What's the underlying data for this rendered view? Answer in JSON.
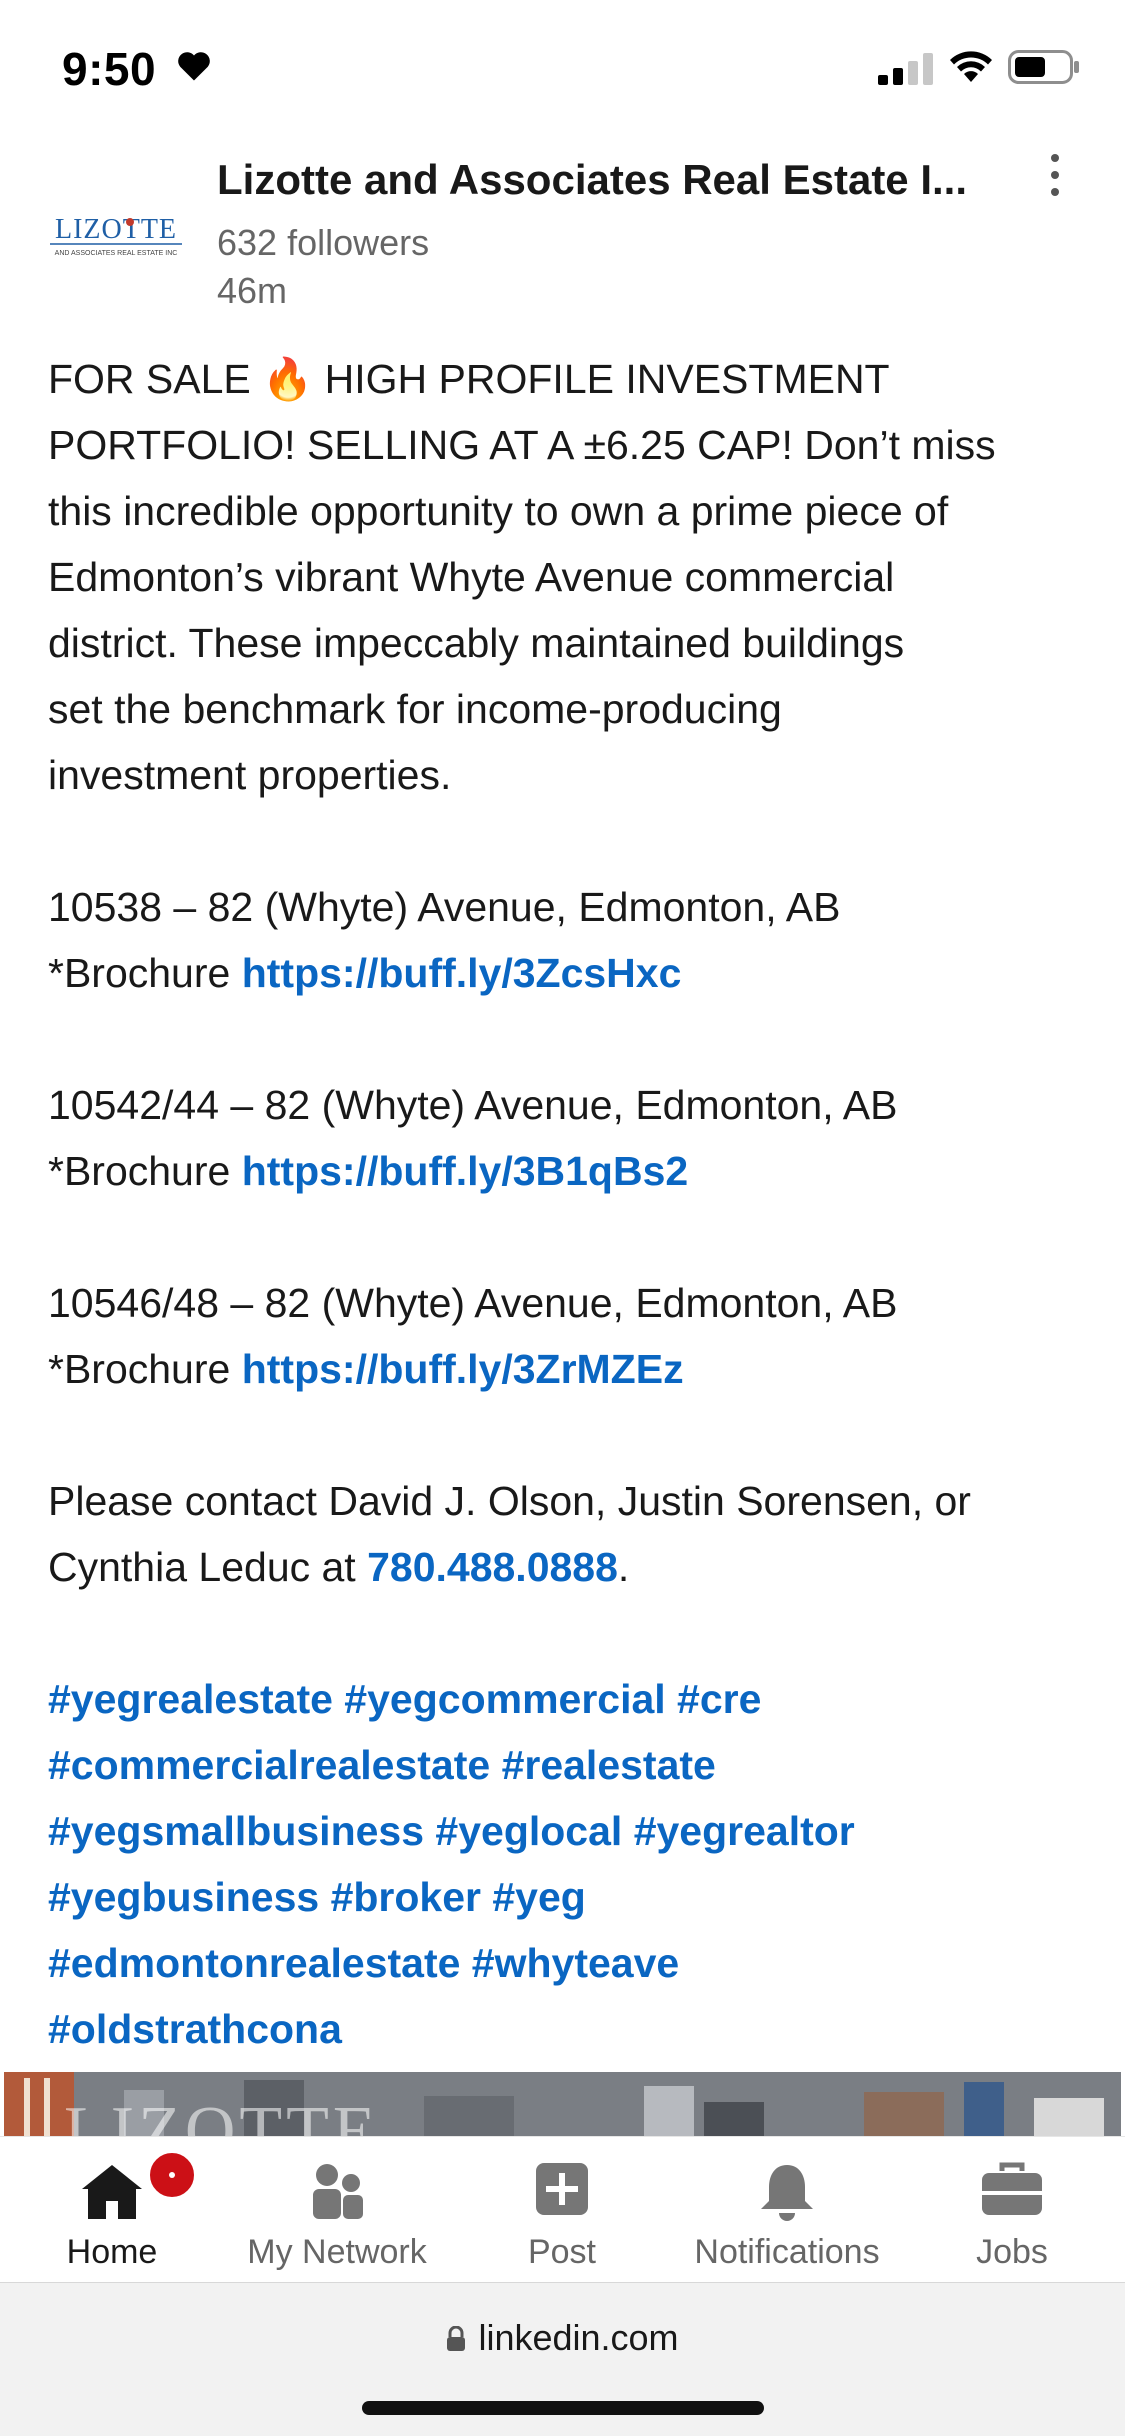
{
  "status": {
    "time": "9:50"
  },
  "post": {
    "author": "Lizotte and Associates Real Estate I...",
    "followers": "632 followers",
    "time_ago": "46m",
    "logo_text": "LIZOTTE",
    "logo_subtext": "AND ASSOCIATES REAL ESTATE INC",
    "intro_line1": "FOR SALE",
    "fire_emoji": "🔥",
    "intro_line1_rest": " HIGH PROFILE INVESTMENT",
    "intro_rest_lines": [
      "PORTFOLIO! SELLING AT A ±6.25 CAP! Don’t miss",
      "this incredible opportunity to own a prime piece of",
      "Edmonton’s vibrant Whyte Avenue commercial",
      "district. These impeccably maintained buildings",
      "set the benchmark for income-producing",
      "investment properties."
    ],
    "listings": [
      {
        "address": "10538 – 82 (Whyte) Avenue, Edmonton, AB",
        "brochure_label": "*Brochure ",
        "url": "https://buff.ly/3ZcsHxc"
      },
      {
        "address": "10542/44 – 82 (Whyte) Avenue, Edmonton, AB",
        "brochure_label": "*Brochure ",
        "url": "https://buff.ly/3B1qBs2"
      },
      {
        "address": "10546/48 – 82 (Whyte) Avenue, Edmonton, AB",
        "brochure_label": "*Brochure ",
        "url": "https://buff.ly/3ZrMZEz"
      }
    ],
    "contact_line1": "Please contact David J. Olson, Justin Sorensen, or",
    "contact_line2_prefix": "Cynthia Leduc at ",
    "phone": "780.488.0888",
    "contact_suffix": ".",
    "hashtag_lines": [
      "#yegrealestate #yegcommercial #cre",
      "#commercialrealestate #realestate",
      "#yegsmallbusiness #yeglocal #yegrealtor",
      "#yegbusiness #broker #yeg",
      "#edmontonrealestate #whyteave",
      "#oldstrathcona"
    ],
    "image_watermark": "LIZOTTE"
  },
  "nav": {
    "items": [
      {
        "label": "Home",
        "icon": "home-icon"
      },
      {
        "label": "My Network",
        "icon": "network-icon"
      },
      {
        "label": "Post",
        "icon": "post-icon"
      },
      {
        "label": "Notifications",
        "icon": "bell-icon"
      },
      {
        "label": "Jobs",
        "icon": "briefcase-icon"
      }
    ]
  },
  "browser": {
    "url": "linkedin.com"
  },
  "colors": {
    "link": "#0a66c2",
    "badge": "#cc1016",
    "text": "#191919",
    "muted": "#666666"
  }
}
